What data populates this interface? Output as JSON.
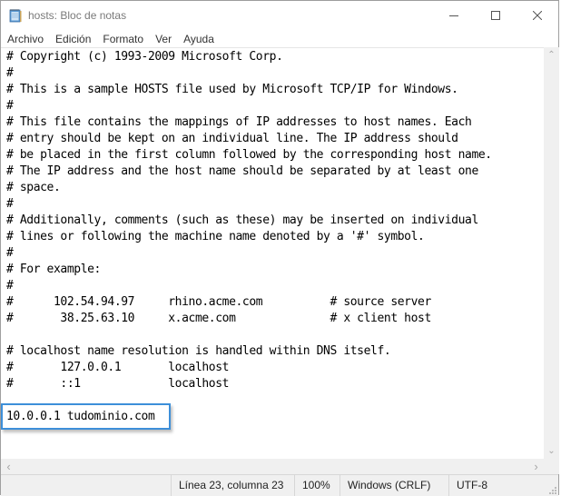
{
  "window": {
    "title": "hosts: Bloc de notas",
    "app_icon": "notepad-icon",
    "controls": [
      "minimize-icon",
      "maximize-icon",
      "close-icon"
    ]
  },
  "menu": {
    "items": [
      "Archivo",
      "Edición",
      "Formato",
      "Ver",
      "Ayuda"
    ]
  },
  "editor": {
    "lines": [
      "# Copyright (c) 1993-2009 Microsoft Corp.",
      "#",
      "# This is a sample HOSTS file used by Microsoft TCP/IP for Windows.",
      "#",
      "# This file contains the mappings of IP addresses to host names. Each",
      "# entry should be kept on an individual line. The IP address should",
      "# be placed in the first column followed by the corresponding host name.",
      "# The IP address and the host name should be separated by at least one",
      "# space.",
      "#",
      "# Additionally, comments (such as these) may be inserted on individual",
      "# lines or following the machine name denoted by a '#' symbol.",
      "#",
      "# For example:",
      "#",
      "#      102.54.94.97     rhino.acme.com          # source server",
      "#       38.25.63.10     x.acme.com              # x client host",
      "",
      "# localhost name resolution is handled within DNS itself.",
      "#\t127.0.0.1       localhost",
      "#\t::1             localhost",
      "",
      "10.0.0.1 tudominio.com"
    ],
    "highlighted_line_index": 22,
    "highlight_color": "#3d8fd9"
  },
  "scrollbars": {
    "up": "chevron-up-icon",
    "down": "chevron-down-icon",
    "left": "chevron-left-icon",
    "right": "chevron-right-icon"
  },
  "status": {
    "position": "Línea 23, columna 23",
    "zoom": "100%",
    "line_ending": "Windows (CRLF)",
    "encoding": "UTF-8"
  }
}
